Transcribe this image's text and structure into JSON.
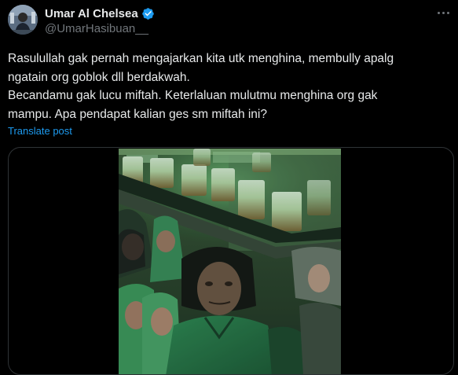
{
  "author": {
    "display_name": "Umar Al Chelsea",
    "handle": "@UmarHasibuan__",
    "verified": true
  },
  "tweet": {
    "lines": [
      "Rasulullah gak pernah mengajarkan kita utk menghina, membully apalg",
      "ngatain org goblok dll berdakwah.",
      "Becandamu gak lucu miftah. Keterlaluan mulutmu menghina org gak",
      "mampu. Apa pendapat kalian ges sm miftah ini?"
    ],
    "translate_label": "Translate post"
  },
  "icons": {
    "verified": "verified-badge-icon",
    "more": "more-options-icon"
  },
  "colors": {
    "background": "#000000",
    "text": "#e7e9ea",
    "secondary": "#71767b",
    "accent": "#1d9bf0"
  }
}
